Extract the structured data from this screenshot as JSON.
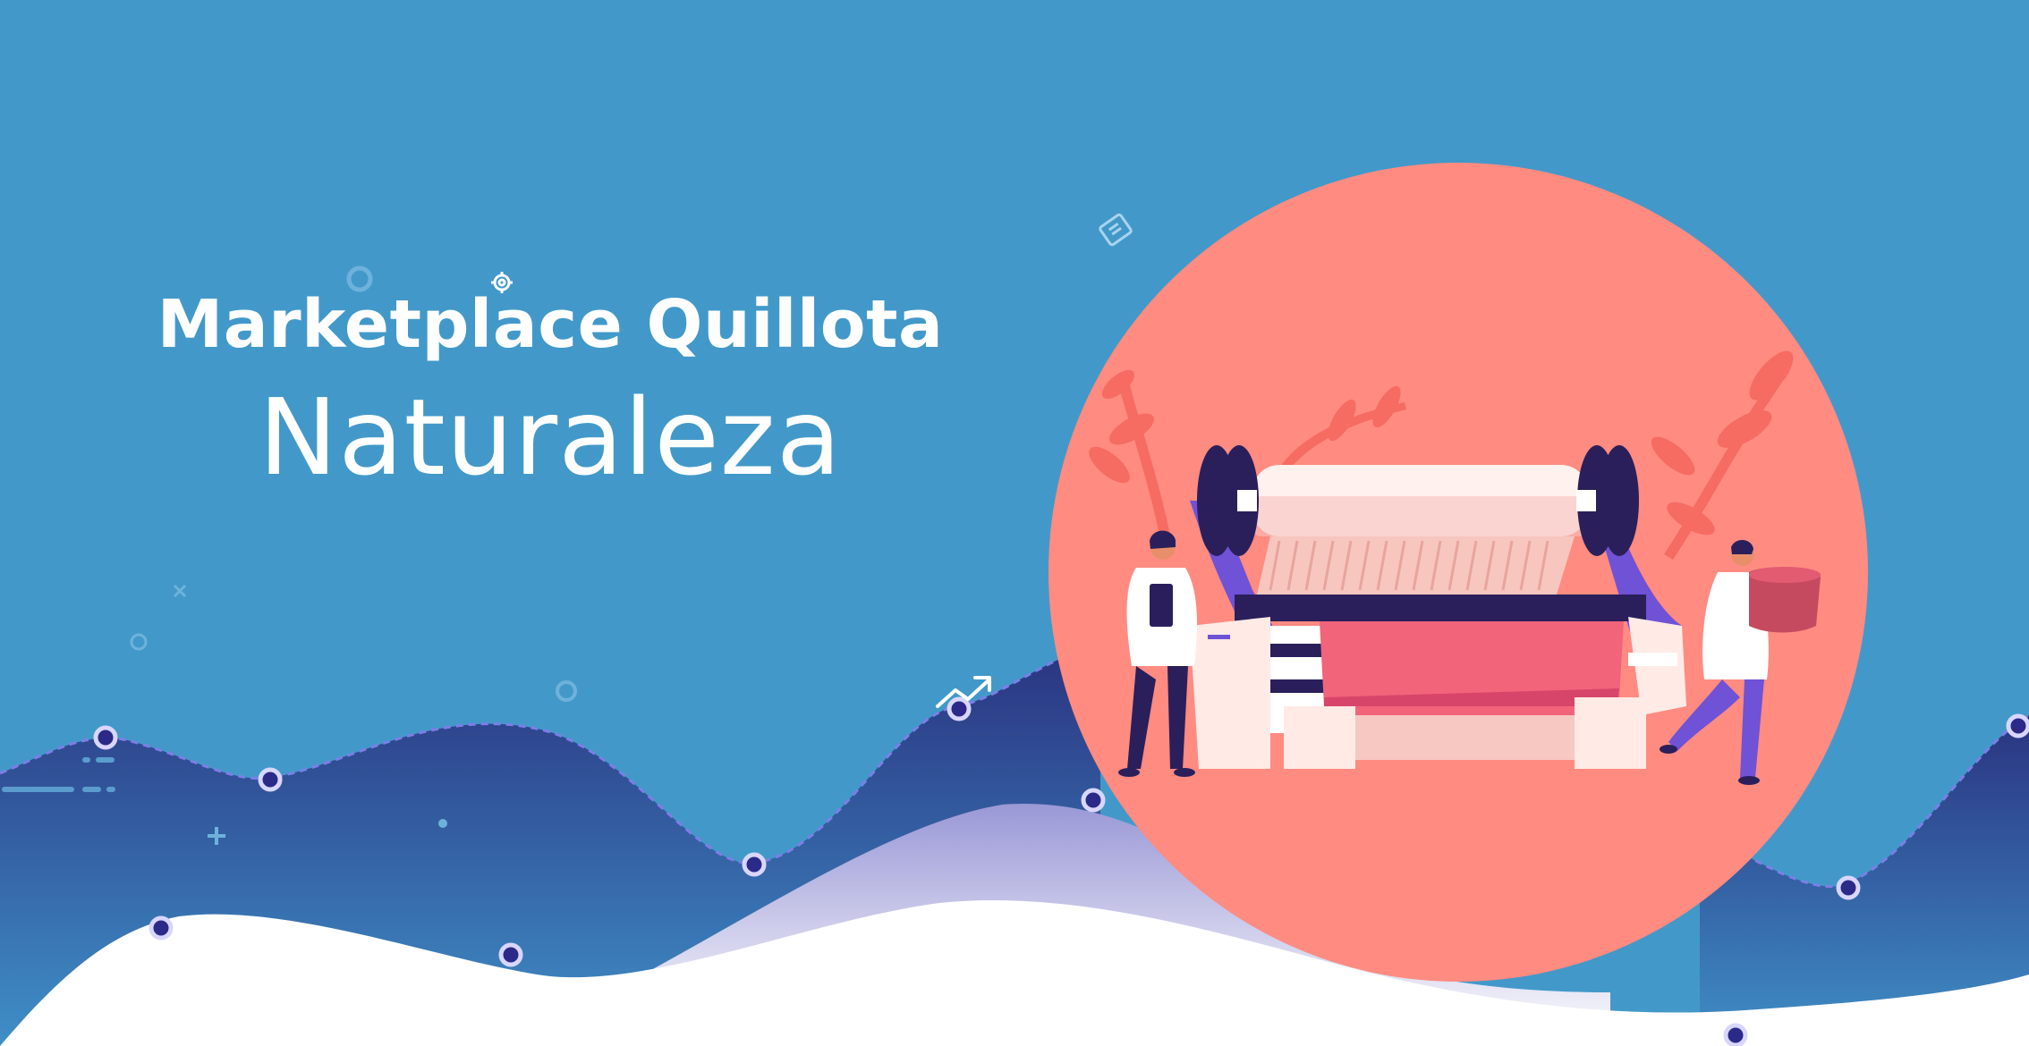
{
  "banner": {
    "title": "Marketplace Quillota",
    "subtitle": "Naturaleza"
  },
  "colors": {
    "background": "#4299c9",
    "wave_dark": "#2e3f8e",
    "wave_light": "#ffffff",
    "circle": "#ff8b81",
    "accent_purple": "#6f52d6",
    "dot_fill": "#2b2a88"
  },
  "icons": [
    "gear-icon",
    "document-icon",
    "trend-arrow-icon",
    "circle-icon",
    "plus-icon",
    "x-icon"
  ]
}
